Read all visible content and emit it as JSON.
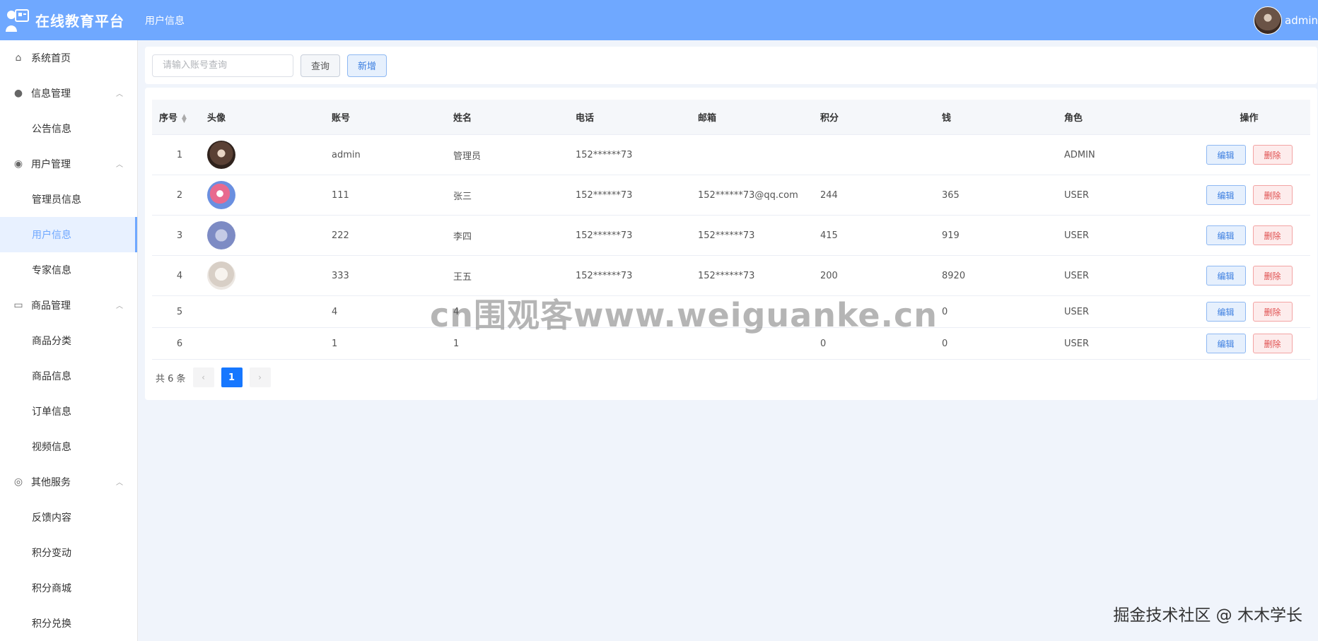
{
  "header": {
    "app_title": "在线教育平台",
    "breadcrumb": "用户信息",
    "user_name": "admin",
    "bg_color": "#6fa8ff"
  },
  "sidebar": {
    "items": [
      {
        "label": "系统首页",
        "icon": "home-icon"
      },
      {
        "label": "信息管理",
        "icon": "bulb-icon",
        "group": true
      },
      {
        "label": "公告信息",
        "sub": true
      },
      {
        "label": "用户管理",
        "icon": "eye-icon",
        "group": true
      },
      {
        "label": "管理员信息",
        "sub": true
      },
      {
        "label": "用户信息",
        "sub": true,
        "active": true
      },
      {
        "label": "专家信息",
        "sub": true
      },
      {
        "label": "商品管理",
        "icon": "box-icon",
        "group": true
      },
      {
        "label": "商品分类",
        "sub": true
      },
      {
        "label": "商品信息",
        "sub": true
      },
      {
        "label": "订单信息",
        "sub": true
      },
      {
        "label": "视频信息",
        "sub": true
      },
      {
        "label": "其他服务",
        "icon": "medal-icon",
        "group": true
      },
      {
        "label": "反馈内容",
        "sub": true
      },
      {
        "label": "积分变动",
        "sub": true
      },
      {
        "label": "积分商城",
        "sub": true
      },
      {
        "label": "积分兑换",
        "sub": true
      }
    ]
  },
  "search": {
    "placeholder": "请输入账号查询",
    "query_label": "查询",
    "add_label": "新增"
  },
  "table": {
    "columns": [
      "序号",
      "头像",
      "账号",
      "姓名",
      "电话",
      "邮箱",
      "积分",
      "钱",
      "角色",
      "操作"
    ],
    "rows": [
      {
        "no": "1",
        "avatar": true,
        "account": "admin",
        "name": "管理员",
        "phone": "152******73",
        "email": "",
        "score": "",
        "money": "",
        "role": "ADMIN"
      },
      {
        "no": "2",
        "avatar": true,
        "account": "111",
        "name": "张三",
        "phone": "152******73",
        "email": "152******73@qq.com",
        "score": "244",
        "money": "365",
        "role": "USER"
      },
      {
        "no": "3",
        "avatar": true,
        "account": "222",
        "name": "李四",
        "phone": "152******73",
        "email": "152******73",
        "score": "415",
        "money": "919",
        "role": "USER"
      },
      {
        "no": "4",
        "avatar": true,
        "account": "333",
        "name": "王五",
        "phone": "152******73",
        "email": "152******73",
        "score": "200",
        "money": "8920",
        "role": "USER"
      },
      {
        "no": "5",
        "avatar": false,
        "account": "4",
        "name": "4",
        "phone": "",
        "email": "",
        "score": "",
        "money": "0",
        "role": "USER"
      },
      {
        "no": "6",
        "avatar": false,
        "account": "1",
        "name": "1",
        "phone": "",
        "email": "",
        "score": "0",
        "money": "0",
        "role": "USER"
      }
    ],
    "edit_label": "编辑",
    "delete_label": "删除"
  },
  "pagination": {
    "total_text": "共 6 条",
    "current_page": "1",
    "prev_icon": "‹",
    "next_icon": "›"
  },
  "overlay": {
    "watermark": "cn围观客www.weiguanke.cn",
    "credit": "掘金技术社区 @ 木木学长"
  }
}
